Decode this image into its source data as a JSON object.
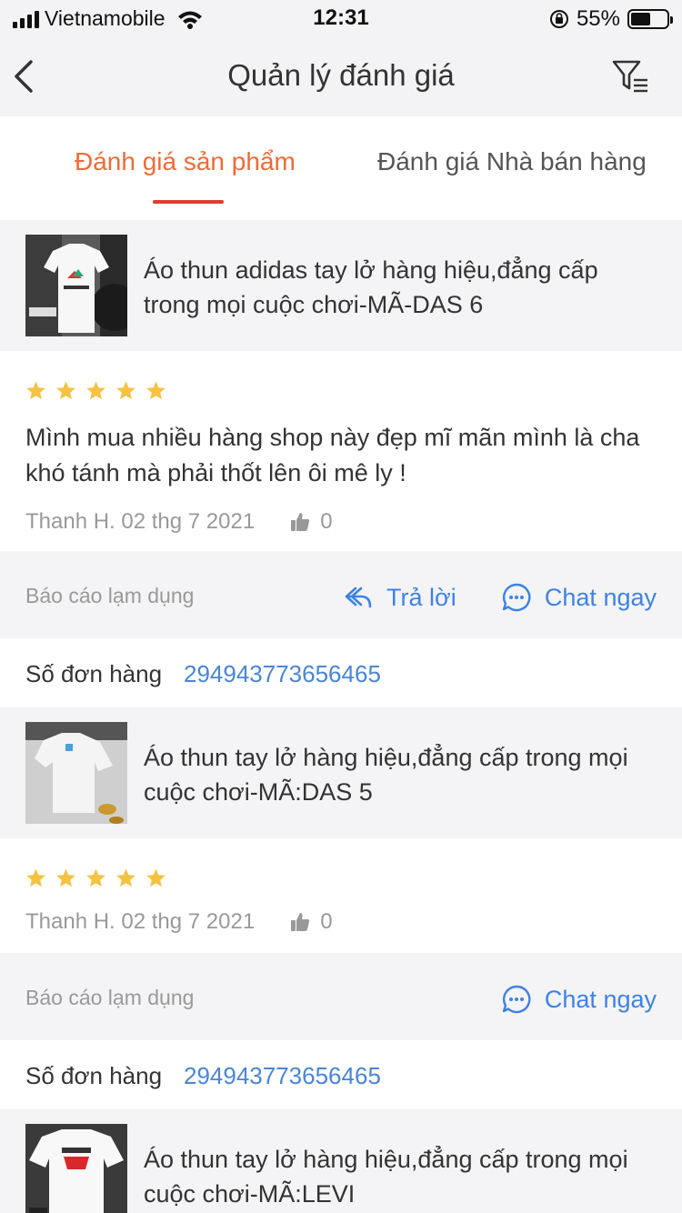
{
  "status_bar": {
    "carrier": "Vietnamobile",
    "time": "12:31",
    "battery": "55%",
    "battery_level": 0.55
  },
  "navbar": {
    "title": "Quản lý đánh giá"
  },
  "tabs": [
    {
      "label": "Đánh giá sản phẩm",
      "active": true
    },
    {
      "label": "Đánh giá Nhà bán hàng",
      "active": false
    }
  ],
  "reviews": [
    {
      "product_name": "Áo thun adidas tay lở hàng hiệu,đẳng cấp trong mọi cuộc chơi-MÃ-DAS 6",
      "rating": 5,
      "text": "Mình mua nhiều hàng shop này đẹp mĩ mãn mình là cha khó tánh mà phải thốt lên ôi mê ly !",
      "author_date": "Thanh H. 02 thg 7 2021",
      "likes": "0",
      "report_label": "Báo cáo lạm dụng",
      "reply_label": "Trả lời",
      "chat_label": "Chat ngay",
      "order_label": "Số đơn hàng",
      "order_number": "294943773656465"
    },
    {
      "product_name": "Áo thun tay lở hàng hiệu,đẳng cấp trong mọi cuộc chơi-MÃ:DAS 5",
      "rating": 5,
      "author_date": "Thanh H. 02 thg 7 2021",
      "likes": "0",
      "report_label": "Báo cáo lạm dụng",
      "chat_label": "Chat ngay",
      "order_label": "Số đơn hàng",
      "order_number": "294943773656465"
    },
    {
      "product_name": "Áo thun tay lở hàng hiệu,đẳng cấp trong mọi cuộc chơi-MÃ:LEVI"
    }
  ],
  "colors": {
    "accent": "#ee6b37",
    "link": "#3e82e4",
    "star": "#f5c242",
    "underline": "#e33b2e"
  }
}
